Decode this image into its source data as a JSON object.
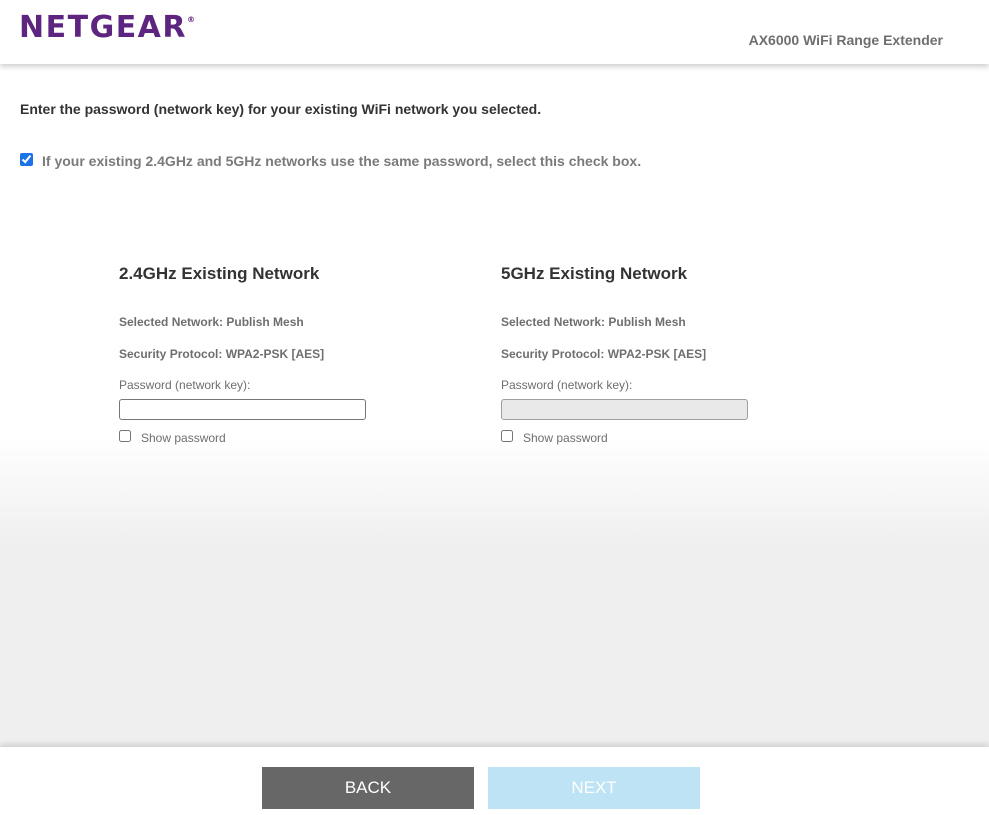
{
  "header": {
    "logo": "NETGEAR",
    "logo_mark": "®",
    "product": "AX6000 WiFi Range Extender",
    "brand_color": "#5d2480"
  },
  "main": {
    "instruction": "Enter the password (network key) for your existing WiFi network you selected.",
    "same_password": {
      "label": "If your existing 2.4GHz and 5GHz networks use the same password, select this check box.",
      "checked": true
    },
    "networks": [
      {
        "title": "2.4GHz Existing Network",
        "selected_network": "Selected Network: Publish Mesh",
        "security": "Security Protocol: WPA2-PSK [AES]",
        "password_label": "Password (network key):",
        "password_value": "",
        "enabled": true,
        "show_password_label": "Show password"
      },
      {
        "title": "5GHz Existing Network",
        "selected_network": "Selected Network: Publish Mesh",
        "security": "Security Protocol: WPA2-PSK [AES]",
        "password_label": "Password (network key):",
        "password_value": "",
        "enabled": false,
        "show_password_label": "Show password"
      }
    ]
  },
  "footer": {
    "back_label": "BACK",
    "next_label": "NEXT",
    "back_color": "#676767",
    "next_color": "#bde3f5"
  }
}
